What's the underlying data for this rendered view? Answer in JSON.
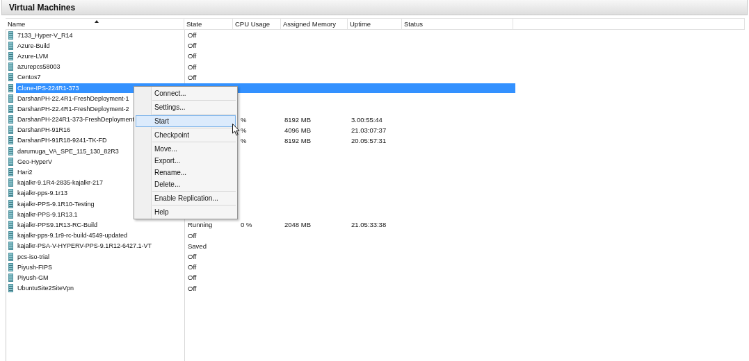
{
  "panel": {
    "title": "Virtual Machines"
  },
  "table": {
    "columns": [
      {
        "label": "Name",
        "sort_ascending": true
      },
      {
        "label": "State",
        "sort_ascending": false
      },
      {
        "label": "CPU Usage",
        "sort_ascending": false
      },
      {
        "label": "Assigned Memory",
        "sort_ascending": false
      },
      {
        "label": "Uptime",
        "sort_ascending": false
      },
      {
        "label": "Status",
        "sort_ascending": false
      }
    ],
    "rows": [
      {
        "name": "7133_Hyper-V_R14",
        "state": "Off",
        "selected": false
      },
      {
        "name": "Azure-Build",
        "state": "Off",
        "selected": false
      },
      {
        "name": "Azure-LVM",
        "state": "Off",
        "selected": false
      },
      {
        "name": "azurepcs58003",
        "state": "Off",
        "selected": false
      },
      {
        "name": "Centos7",
        "state": "Off",
        "selected": false
      },
      {
        "name": "Clone-IPS-224R1-373",
        "selected": true
      },
      {
        "name": "DarshanPH-22.4R1-FreshDeployment-1",
        "selected": false
      },
      {
        "name": "DarshanPH-22.4R1-FreshDeployment-2",
        "selected": false
      },
      {
        "name": "DarshanPH-224R1-373-FreshDeployment",
        "cpu": "%",
        "memory": "8192 MB",
        "uptime": "3.00:55:44",
        "selected": false
      },
      {
        "name": "DarshanPH-91R16",
        "cpu": "%",
        "memory": "4096 MB",
        "uptime": "21.03:07:37",
        "selected": false
      },
      {
        "name": "DarshanPH-91R18-9241-TK-FD",
        "cpu": "%",
        "memory": "8192 MB",
        "uptime": "20.05:57:31",
        "selected": false
      },
      {
        "name": "darumuga_VA_SPE_115_130_82R3",
        "selected": false
      },
      {
        "name": "Geo-HyperV",
        "selected": false
      },
      {
        "name": "Hari2",
        "selected": false
      },
      {
        "name": "kajalkr-9.1R4-2835-kajalkr-217",
        "selected": false
      },
      {
        "name": "kajalkr-pps-9.1r13",
        "selected": false
      },
      {
        "name": "kajalkr-PPS-9.1R10-Testing",
        "selected": false
      },
      {
        "name": "kajalkr-PPS-9.1R13.1",
        "selected": false
      },
      {
        "name": "kajalkr-PPS9.1R13-RC-Build",
        "state": "Running",
        "cpu": "0 %",
        "memory": "2048 MB",
        "uptime": "21.05:33:38",
        "selected": false
      },
      {
        "name": "kajalkr-pps-9.1r9-rc-build-4549-updated",
        "state": "Off",
        "selected": false
      },
      {
        "name": "kajalkr-PSA-V-HYPERV-PPS-9.1R12-6427.1-VT",
        "state": "Saved",
        "selected": false
      },
      {
        "name": "pcs-iso-trial",
        "state": "Off",
        "selected": false
      },
      {
        "name": "Piyush-FIPS",
        "state": "Off",
        "selected": false
      },
      {
        "name": "Piyush-GM",
        "state": "Off",
        "selected": false
      },
      {
        "name": "UbuntuSite2SiteVpn",
        "state": "Off",
        "selected": false
      }
    ]
  },
  "context_menu": {
    "groups": [
      [
        {
          "label": "Connect...",
          "selected": false
        }
      ],
      [
        {
          "label": "Settings...",
          "selected": false
        }
      ],
      [
        {
          "label": "Start",
          "selected": true
        }
      ],
      [
        {
          "label": "Checkpoint",
          "selected": false
        }
      ],
      [
        {
          "label": "Move...",
          "selected": false
        },
        {
          "label": "Export...",
          "selected": false
        },
        {
          "label": "Rename...",
          "selected": false
        },
        {
          "label": "Delete...",
          "selected": false
        }
      ],
      [
        {
          "label": "Enable Replication...",
          "selected": false
        }
      ],
      [
        {
          "label": "Help",
          "selected": false
        }
      ]
    ]
  }
}
